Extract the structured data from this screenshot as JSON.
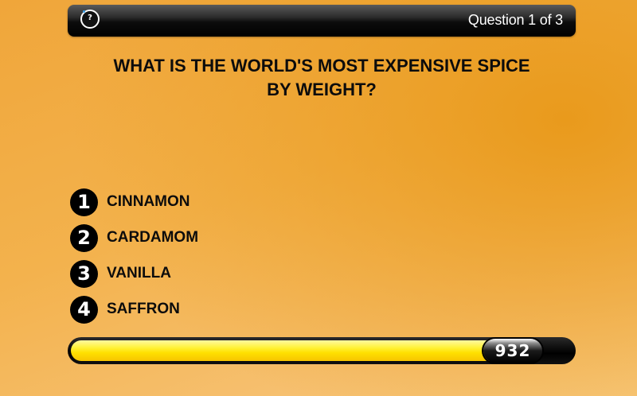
{
  "header": {
    "help_icon": "question-mark-icon",
    "help_label": "?",
    "counter": "Question 1 of 3"
  },
  "question": {
    "line1": "WHAT IS THE WORLD'S MOST EXPENSIVE SPICE",
    "line2": "BY WEIGHT?"
  },
  "answers": [
    {
      "number": "1",
      "label": "CINNAMON"
    },
    {
      "number": "2",
      "label": "CARDAMOM"
    },
    {
      "number": "3",
      "label": "VANILLA"
    },
    {
      "number": "4",
      "label": "SAFFRON"
    }
  ],
  "timer": {
    "points": "932",
    "fraction_remaining": 0.885
  },
  "colors": {
    "background": "#f0a63a",
    "timer_fill": "#ffe000",
    "bar_dark": "#000000",
    "text": "#0c0c0c"
  }
}
